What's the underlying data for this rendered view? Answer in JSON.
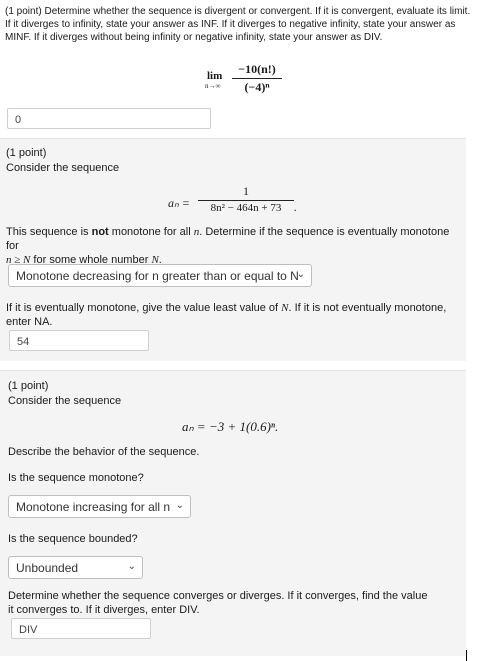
{
  "problem1": {
    "points": "(1 point)",
    "instructions": "Determine whether the sequence is divergent or convergent. If it is convergent, evaluate its limit. If it diverges to infinity, state your answer as INF. If it diverges to negative infinity, state your answer as MINF. If it diverges without being infinity or negative infinity, state your answer as DIV.",
    "limit_label": "lim",
    "limit_sub": "n→∞",
    "numerator": "−10(n!)",
    "denominator": "(−4)ⁿ",
    "answer": "0"
  },
  "problem2": {
    "points": "(1 point)",
    "consider": "Consider the sequence",
    "formula_lhs": "aₙ =",
    "numerator": "1",
    "denominator": "8n² − 464n + 73",
    "formula_end": ".",
    "mono_text_1": "This sequence is ",
    "mono_bold": "not",
    "mono_text_2": " monotone for all ",
    "mono_n": "n",
    "mono_text_3": ". Determine if the sequence is eventually monotone for",
    "mono_text_4": "n ≥ N",
    "mono_text_5": " for some whole number ",
    "mono_text_6": "N",
    "mono_text_7": ".",
    "select_value": "Monotone decreasing for n greater than or equal to N",
    "followup_1": "If it is eventually monotone, give the value least value of ",
    "followup_N": "N",
    "followup_2": ". If it is not eventually monotone, enter NA.",
    "answer": "54"
  },
  "problem3": {
    "points": "(1 point)",
    "consider": "Consider the sequence",
    "formula": "aₙ = −3 + 1(0.6)ⁿ.",
    "describe": "Describe the behavior of the sequence.",
    "q_monotone": "Is the sequence monotone?",
    "select_monotone": "Monotone increasing for all n",
    "q_bounded": "Is the sequence bounded?",
    "select_bounded": "Unbounded",
    "q_converge": "Determine whether the sequence converges or diverges. If it converges, find the value it converges to. If it diverges, enter DIV.",
    "answer": "DIV"
  }
}
